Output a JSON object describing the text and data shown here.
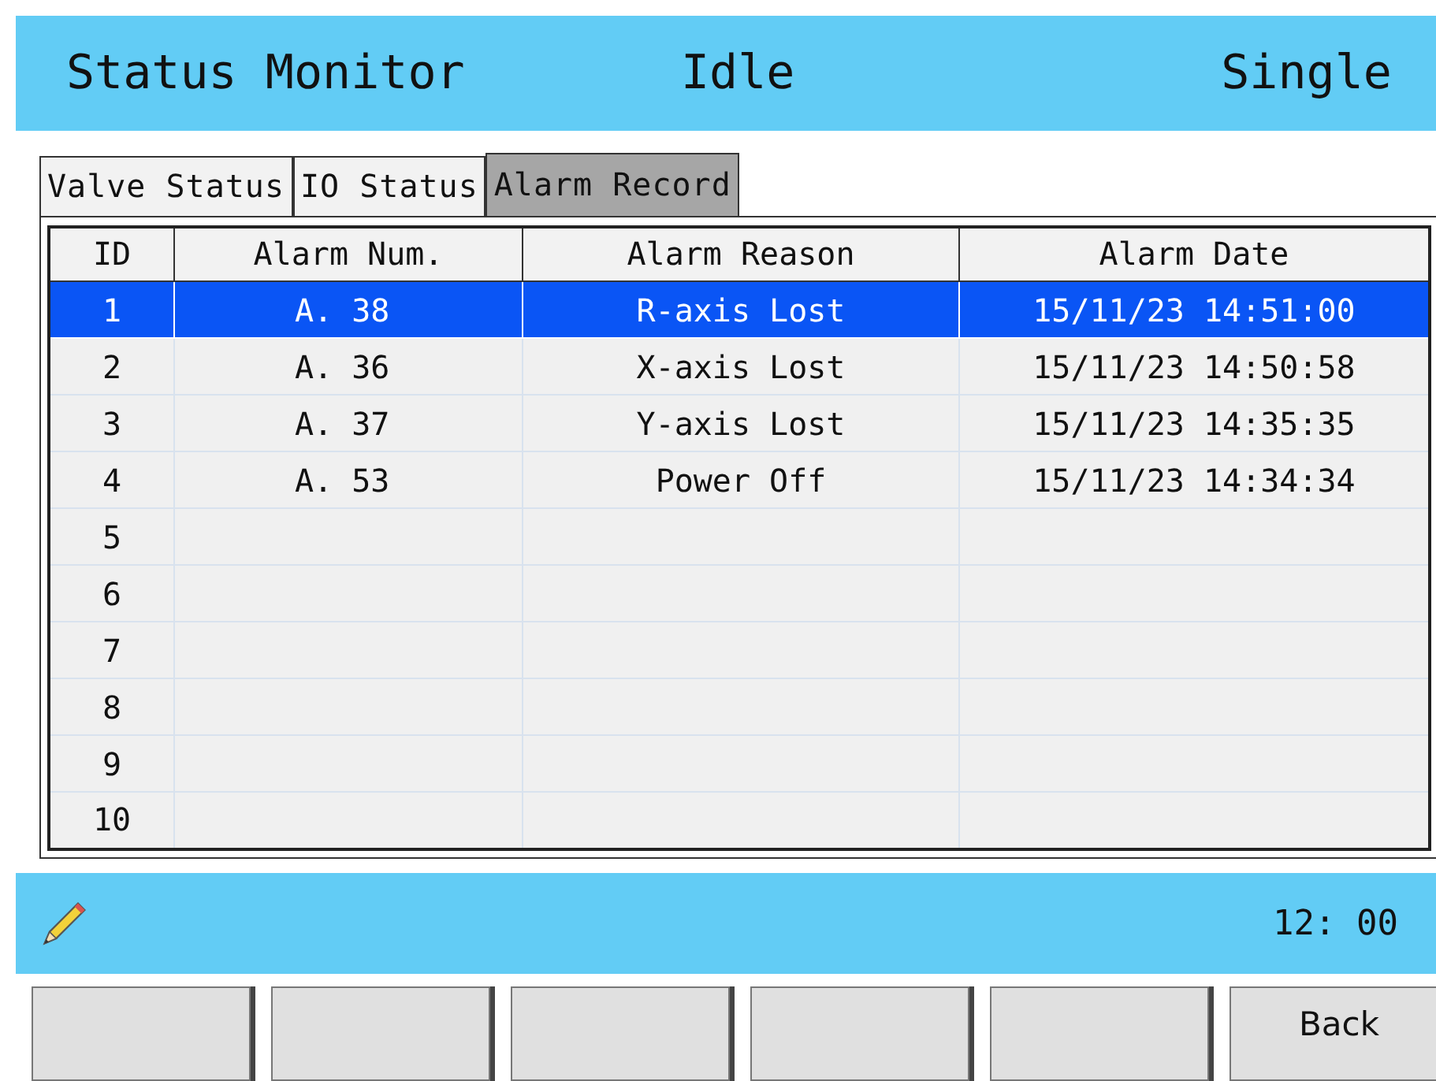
{
  "header": {
    "title": "Status Monitor",
    "state": "Idle",
    "mode": "Single"
  },
  "tabs": [
    {
      "label": "Valve Status",
      "selected": false
    },
    {
      "label": "IO Status",
      "selected": false
    },
    {
      "label": "Alarm Record",
      "selected": true
    }
  ],
  "table": {
    "columns": [
      "ID",
      "Alarm Num.",
      "Alarm Reason",
      "Alarm Date"
    ],
    "rows": [
      {
        "id": "1",
        "alarm_num": "A. 38",
        "reason": "R-axis Lost",
        "date": "15/11/23 14:51:00",
        "selected": true
      },
      {
        "id": "2",
        "alarm_num": "A. 36",
        "reason": "X-axis Lost",
        "date": "15/11/23 14:50:58",
        "selected": false
      },
      {
        "id": "3",
        "alarm_num": "A. 37",
        "reason": "Y-axis Lost",
        "date": "15/11/23 14:35:35",
        "selected": false
      },
      {
        "id": "4",
        "alarm_num": "A. 53",
        "reason": "Power Off",
        "date": "15/11/23 14:34:34",
        "selected": false
      },
      {
        "id": "5",
        "selected": false
      },
      {
        "id": "6",
        "selected": false
      },
      {
        "id": "7",
        "selected": false
      },
      {
        "id": "8",
        "selected": false
      },
      {
        "id": "9",
        "selected": false
      },
      {
        "id": "10",
        "selected": false
      }
    ]
  },
  "status_bar": {
    "time": "12: 00"
  },
  "buttons": [
    {
      "kind": "blank"
    },
    {
      "kind": "blank"
    },
    {
      "kind": "blank"
    },
    {
      "kind": "blank"
    },
    {
      "kind": "blank"
    },
    {
      "kind": "text",
      "label": "Back"
    }
  ]
}
